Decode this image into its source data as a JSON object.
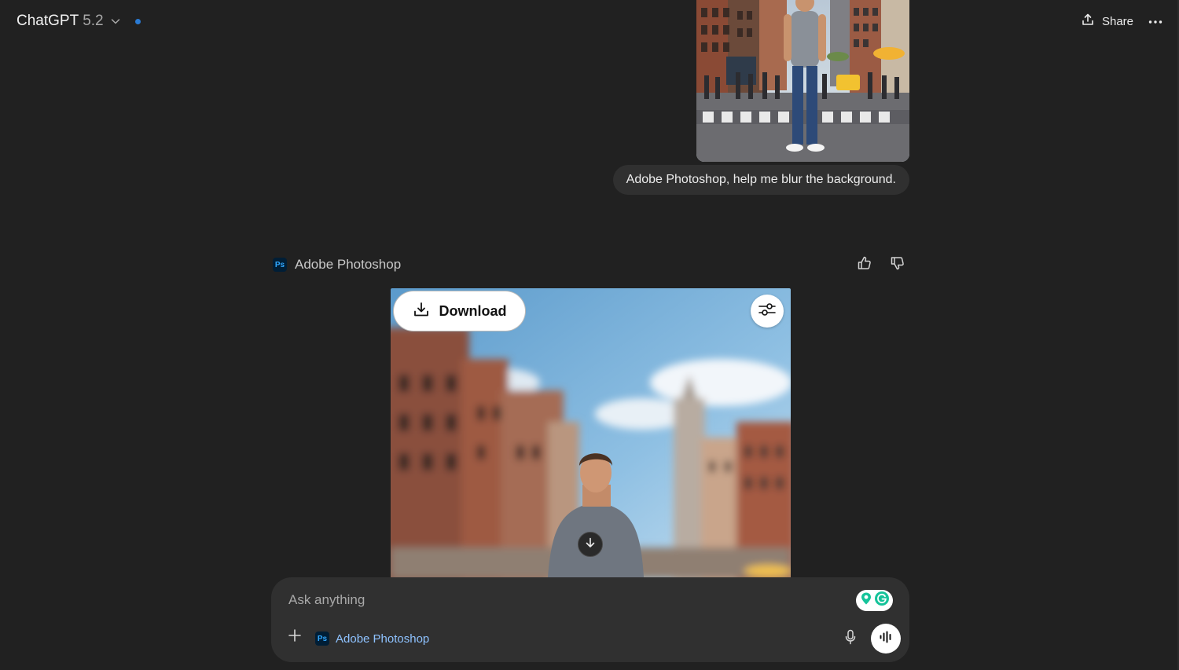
{
  "header": {
    "model_name": "ChatGPT",
    "model_version": "5.2",
    "share_label": "Share",
    "status_dot_color": "#2a7bd4"
  },
  "user_message": {
    "text": "Adobe Photoshop, help me blur the background."
  },
  "assistant": {
    "app_name": "Adobe Photoshop",
    "app_badge": "Ps",
    "download_label": "Download"
  },
  "composer": {
    "placeholder": "Ask anything",
    "tool_badge": "Ps",
    "tool_label": "Adobe Photoshop"
  },
  "colors": {
    "background": "#212121",
    "composer": "#303030",
    "bubble": "#303030",
    "tool_accent": "#8ec2ff",
    "ps_blue": "#31a8ff"
  }
}
